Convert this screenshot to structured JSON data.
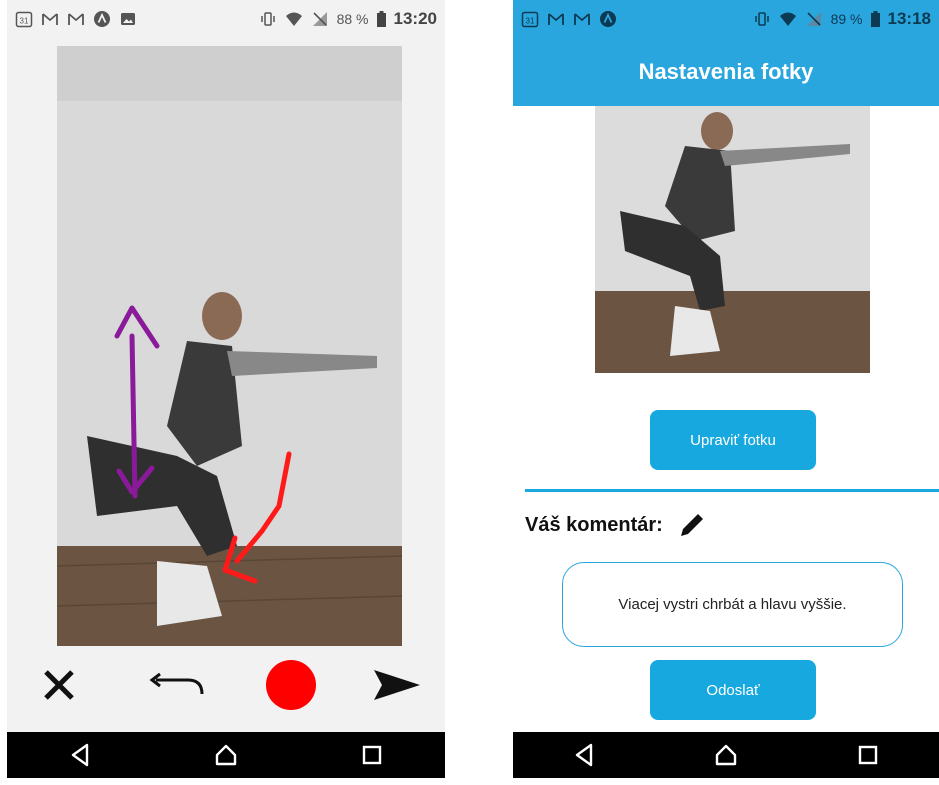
{
  "left_screen": {
    "status": {
      "icons": [
        "calendar-icon",
        "gmail-icon",
        "gmail-icon",
        "app-icon",
        "image-icon"
      ],
      "calendar_day": "31",
      "battery": "88 %",
      "time": "13:20"
    },
    "tools": [
      "close-icon",
      "undo-icon",
      "color-picker-red",
      "send-icon"
    ],
    "annotation_colors": {
      "purple": "#8a1a9a",
      "red": "#ff1a1a"
    }
  },
  "right_screen": {
    "status": {
      "calendar_day": "31",
      "battery": "89 %",
      "time": "13:18"
    },
    "title": "Nastavenia fotky",
    "edit_button": "Upraviť fotku",
    "comment_label": "Váš komentár:",
    "comment_text": "Viacej vystri chrbát a hlavu vyššie.",
    "send_button": "Odoslať"
  },
  "nav": [
    "back-icon",
    "home-icon",
    "recents-icon"
  ],
  "colors": {
    "accent": "#2aa6df",
    "button": "#16a8df",
    "nav": "#000000"
  }
}
